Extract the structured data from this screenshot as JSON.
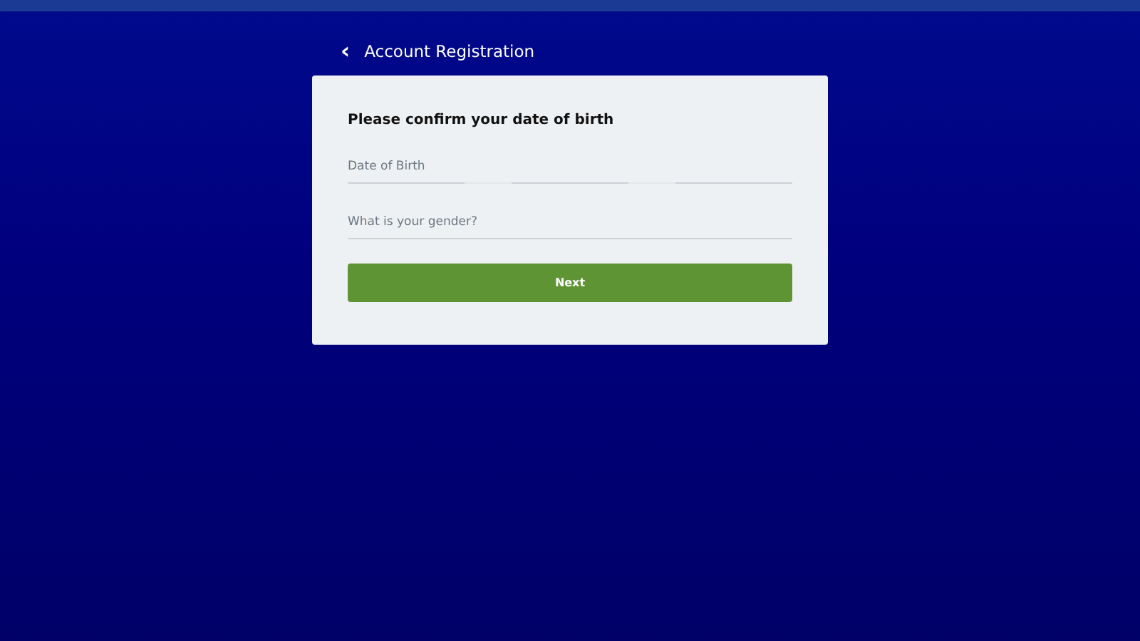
{
  "header": {
    "back": "‹",
    "title": "Account Registration"
  },
  "form": {
    "heading": "Please confirm your date of birth",
    "fields": [
      {
        "kind": "date",
        "placeholder": "Date of Birth"
      },
      {
        "kind": "text",
        "placeholder": "What is your gender?"
      }
    ],
    "button": "Next"
  }
}
